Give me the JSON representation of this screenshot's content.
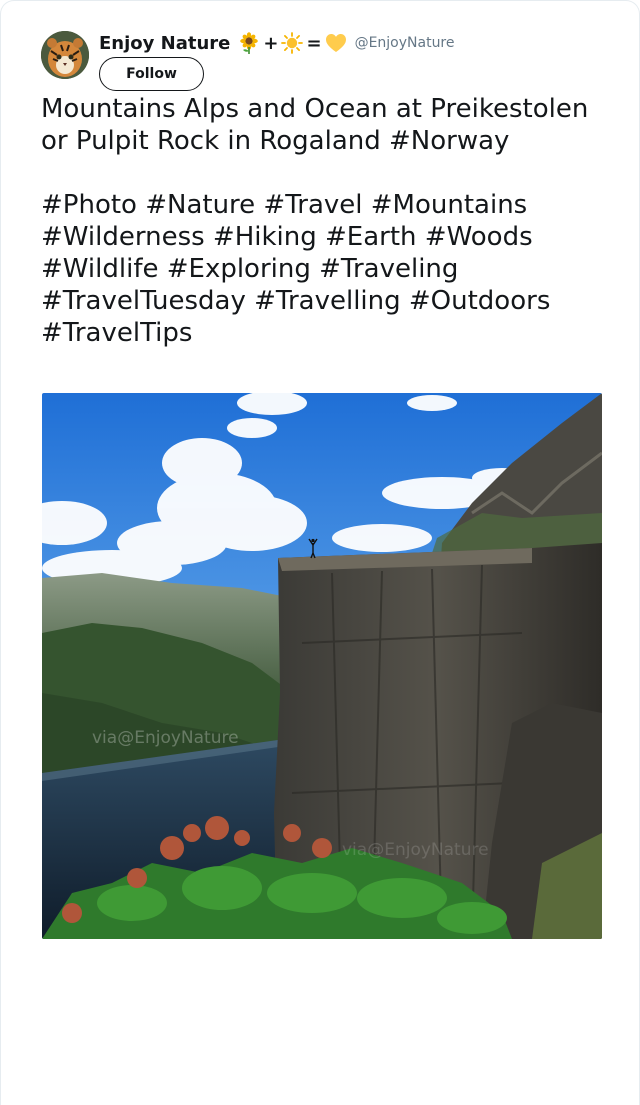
{
  "user": {
    "display_name": "Enjoy Nature",
    "handle": "@EnjoyNature",
    "emoji_icons": [
      "sunflower-icon",
      "plus",
      "sun-icon",
      "equals",
      "yellow-heart-icon"
    ],
    "avatar_icon": "tiger-avatar"
  },
  "follow_button": {
    "label": "Follow"
  },
  "tweet": {
    "line1": "Mountains Alps and Ocean at Preikestolen or Pulpit Rock in Rogaland #Norway",
    "hashtags": "#Photo #Nature #Travel #Mountains #Wilderness #Hiking #Earth #Woods #Wildlife #Exploring #Traveling #TravelTuesday #Travelling #Outdoors #TravelTips"
  },
  "photo": {
    "watermark_1": "via@EnjoyNature",
    "watermark_2": "via@EnjoyNature"
  },
  "colors": {
    "text": "#14171a",
    "secondary": "#657786",
    "border": "#e6ecf0"
  }
}
